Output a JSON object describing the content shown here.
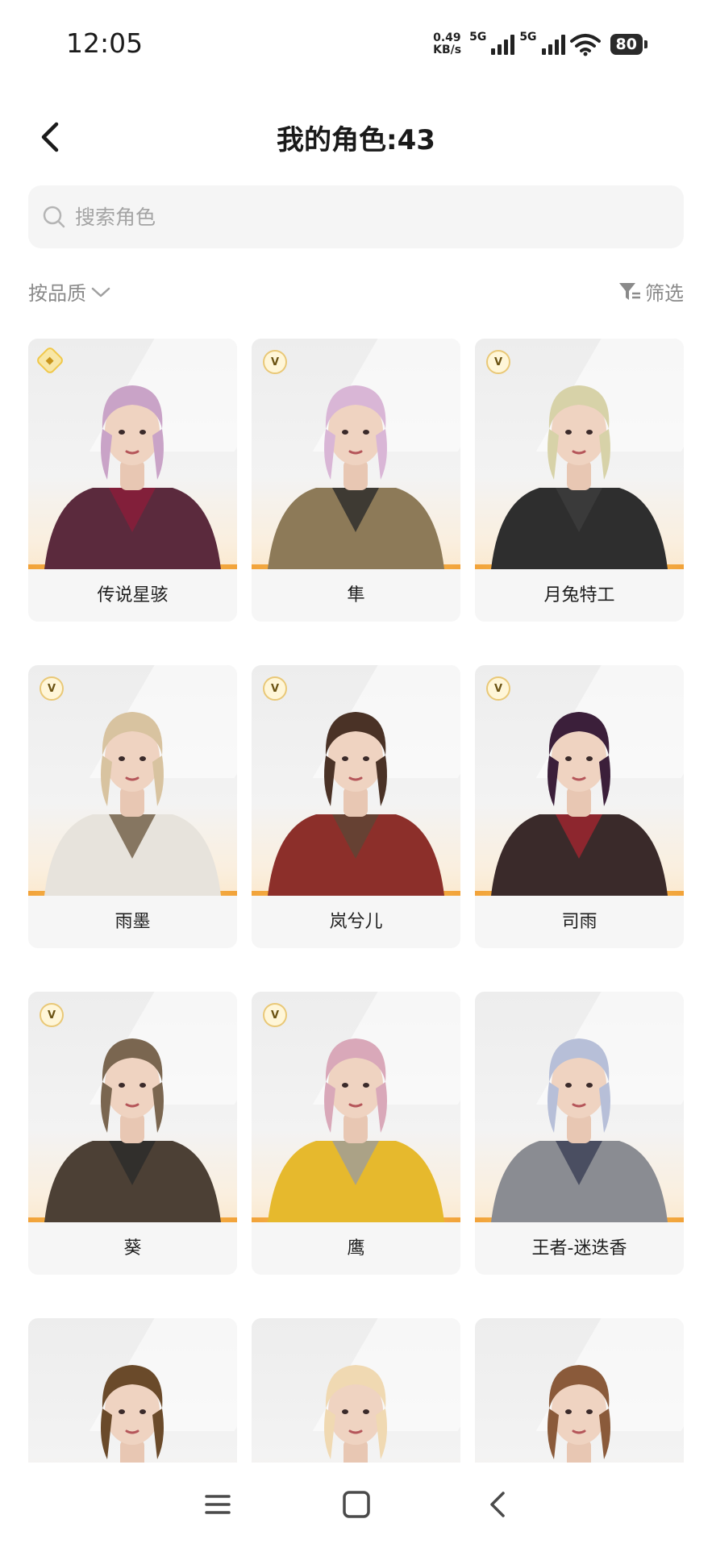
{
  "status": {
    "time": "12:05",
    "net_speed_value": "0.49",
    "net_speed_unit": "KB/s",
    "signal1_label": "5G",
    "signal2_label": "5G",
    "battery": "80"
  },
  "header": {
    "title": "我的角色:43"
  },
  "search": {
    "placeholder": "搜索角色",
    "value": ""
  },
  "toolbar": {
    "sort_label": "按品质",
    "filter_label": "筛选"
  },
  "characters": [
    {
      "name": "传说星骇",
      "badge": "gem",
      "hair": "#c9a3c7",
      "outfit": "#5b2a3d",
      "accent": "#8c1d3a"
    },
    {
      "name": "隼",
      "badge": "V",
      "hair": "#d9b6d6",
      "outfit": "#8d7a58",
      "accent": "#2b2b2b"
    },
    {
      "name": "月兔特工",
      "badge": "V",
      "hair": "#d7d2a8",
      "outfit": "#2e2e2e",
      "accent": "#3d3d3d"
    },
    {
      "name": "雨墨",
      "badge": "V",
      "hair": "#d8c3a0",
      "outfit": "#e7e3dc",
      "accent": "#6e5a42"
    },
    {
      "name": "岚兮儿",
      "badge": "V",
      "hair": "#4a3226",
      "outfit": "#8c2f2a",
      "accent": "#5c4636"
    },
    {
      "name": "司雨",
      "badge": "V",
      "hair": "#3b1f3a",
      "outfit": "#3a2a2a",
      "accent": "#a3262f"
    },
    {
      "name": "葵",
      "badge": "V",
      "hair": "#7a6650",
      "outfit": "#4c4035",
      "accent": "#2a2a2a"
    },
    {
      "name": "鹰",
      "badge": "V",
      "hair": "#d9a8b9",
      "outfit": "#e6b92d",
      "accent": "#9c9c9c"
    },
    {
      "name": "王者-迷迭香",
      "badge": "",
      "hair": "#b7bfd8",
      "outfit": "#8a8c92",
      "accent": "#3a3f55"
    },
    {
      "name": "",
      "badge": "",
      "hair": "#6a4a2a",
      "outfit": "#c9a23a",
      "accent": "#b08a4a"
    },
    {
      "name": "",
      "badge": "",
      "hair": "#f0d9b2",
      "outfit": "#b4423a",
      "accent": "#8a2a22"
    },
    {
      "name": "",
      "badge": "",
      "hair": "#8a5a3a",
      "outfit": "#a32a32",
      "accent": "#6a1a22"
    }
  ],
  "nav": {
    "menu_icon": "menu-icon",
    "home_icon": "home-square-icon",
    "back_icon": "back-chevron-icon"
  }
}
